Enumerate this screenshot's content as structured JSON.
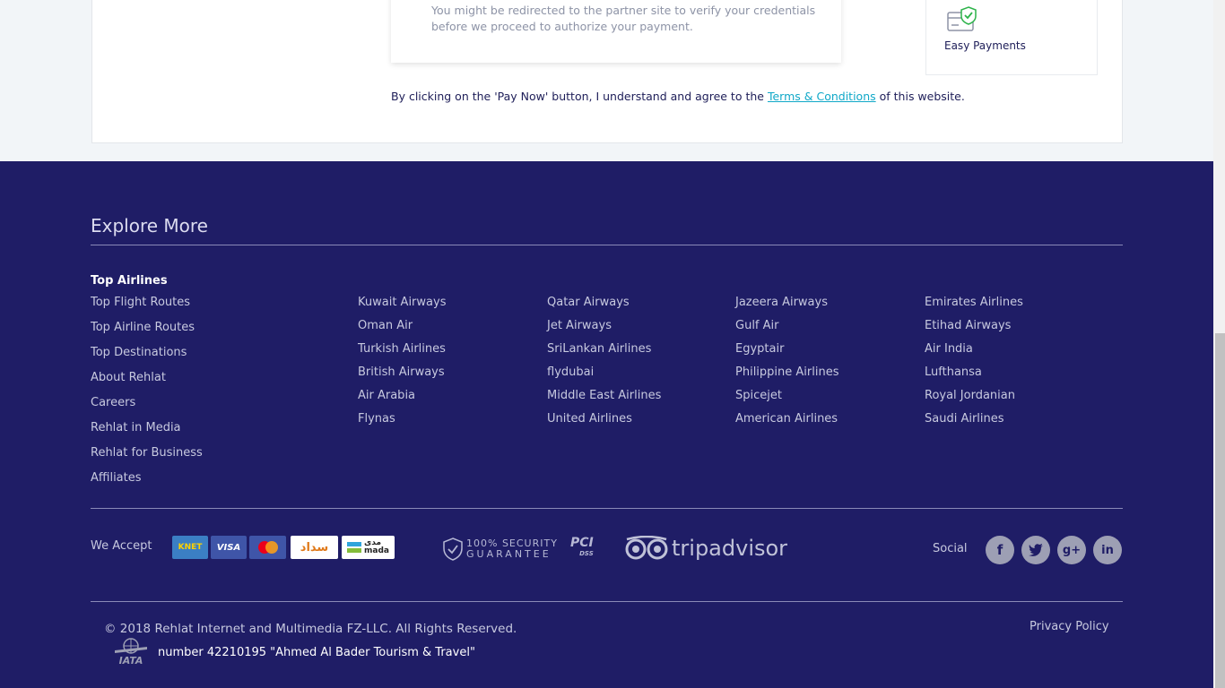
{
  "payment": {
    "redirect_notice": "You might be redirected to the partner site to verify your credentials before we proceed to authorize your payment.",
    "easy_payments_label": "Easy Payments",
    "terms_prefix": "By clicking on the 'Pay Now' button, I understand and agree to the",
    "terms_link": "Terms & Conditions",
    "terms_suffix": "of this website."
  },
  "footer": {
    "explore_title": "Explore More",
    "left_links": {
      "heading": "Top Airlines",
      "items": [
        "Top Flight Routes",
        "Top Airline Routes",
        "Top Destinations",
        "About Rehlat",
        "Careers",
        "Rehlat in Media",
        "Rehlat for Business",
        "Affiliates"
      ]
    },
    "airline_columns": [
      [
        "Kuwait Airways",
        "Oman Air",
        "Turkish Airlines",
        "British Airways",
        "Air Arabia",
        "Flynas"
      ],
      [
        "Qatar Airways",
        "Jet Airways",
        "SriLankan Airlines",
        "flydubai",
        "Middle East Airlines",
        "United Airlines"
      ],
      [
        "Jazeera Airways",
        "Gulf Air",
        "Egyptair",
        "Philippine Airlines",
        "Spicejet",
        "American Airlines"
      ],
      [
        "Emirates Airlines",
        "Etihad Airways",
        "Air India",
        "Lufthansa",
        "Royal Jordanian",
        "Saudi Airlines"
      ]
    ],
    "we_accept": "We Accept",
    "cards": {
      "knet": "KNET",
      "visa": "VISA",
      "mastercard": "MasterCard",
      "sadad": "سداد",
      "mada_ar": "مدى",
      "mada": "mada"
    },
    "security": {
      "line1": "100% SECURITY",
      "line2": "GUARANTEE"
    },
    "pci": {
      "main": "PCI",
      "sub": "DSS"
    },
    "tripadvisor": "tripadvisor",
    "social_label": "Social",
    "social_icons": [
      "facebook-icon",
      "twitter-icon",
      "google-plus-icon",
      "linkedin-icon"
    ],
    "copyright": "© 2018 Rehlat Internet and Multimedia FZ-LLC. All Rights Reserved.",
    "privacy": "Privacy Policy",
    "license": "number 42210195 \"Ahmed Al Bader Tourism & Travel\"",
    "iata": "IATA"
  },
  "colors": {
    "footer_bg": "#1f1d66",
    "link": "#10a8c8"
  }
}
